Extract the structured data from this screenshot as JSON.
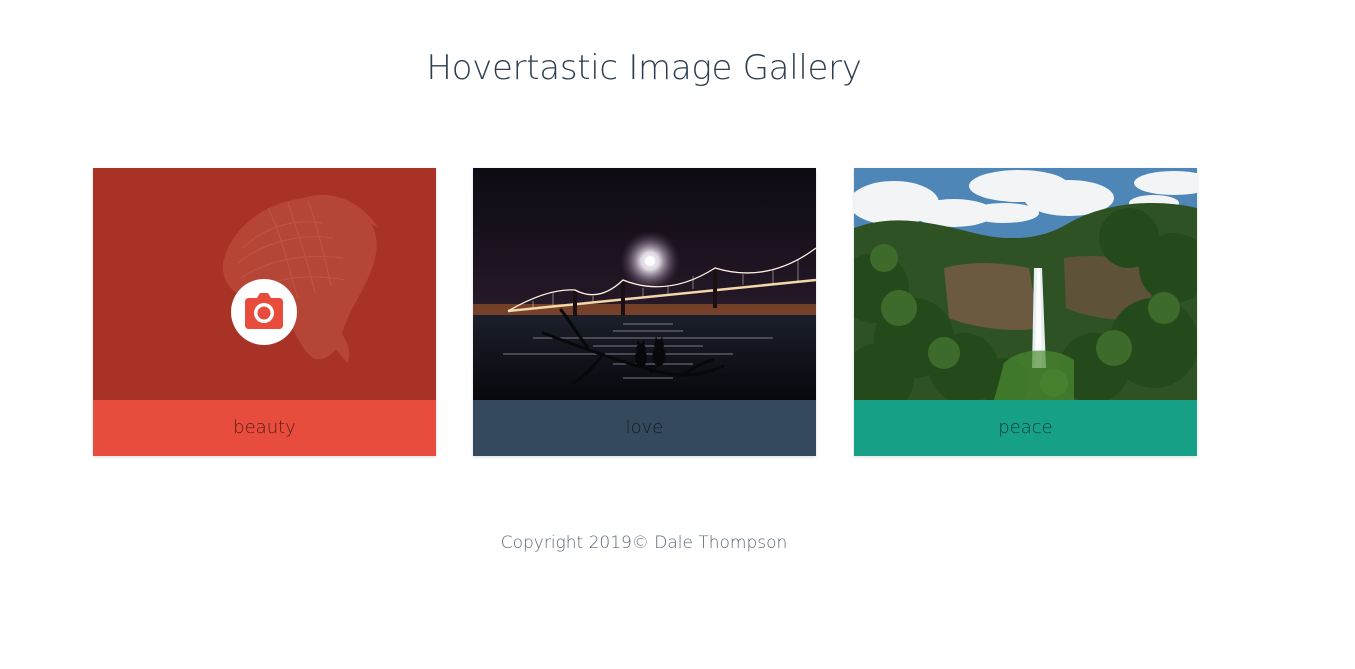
{
  "page": {
    "title": "Hovertastic Image Gallery"
  },
  "gallery": {
    "cards": [
      {
        "caption": "beauty",
        "caption_color": "#e74c3c",
        "overlay_color": "#a93226",
        "image": "betta-fish-photo",
        "hover_icon": "camera-icon"
      },
      {
        "caption": "love",
        "caption_color": "#34495e",
        "image": "bridge-night-photo"
      },
      {
        "caption": "peace",
        "caption_color": "#16a085",
        "image": "waterfall-forest-photo"
      }
    ]
  },
  "footer": {
    "copyright": "Copyright 2019© Dale Thompson"
  }
}
